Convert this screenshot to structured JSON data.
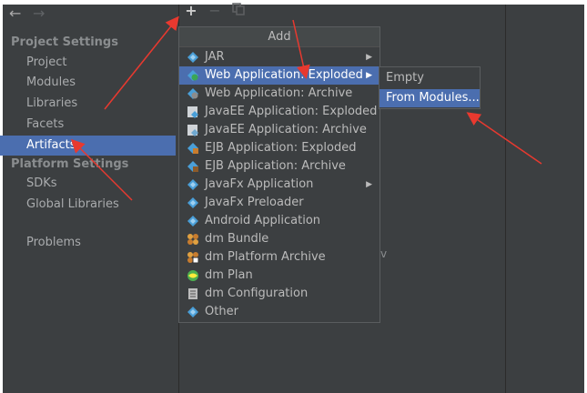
{
  "nav": {
    "back_icon": "arrow-left-icon",
    "forward_icon": "arrow-right-icon"
  },
  "sidebar": {
    "project_settings_title": "Project Settings",
    "project_items": [
      {
        "label": "Project",
        "selected": false
      },
      {
        "label": "Modules",
        "selected": false
      },
      {
        "label": "Libraries",
        "selected": false
      },
      {
        "label": "Facets",
        "selected": false
      },
      {
        "label": "Artifacts",
        "selected": true
      }
    ],
    "platform_settings_title": "Platform Settings",
    "platform_items": [
      {
        "label": "SDKs"
      },
      {
        "label": "Global Libraries"
      }
    ],
    "other_items": [
      {
        "label": "Problems"
      }
    ]
  },
  "toolbar": {
    "add_icon": "plus-icon",
    "remove_icon": "minus-icon",
    "copy_icon": "copy-icon"
  },
  "add_menu": {
    "title": "Add",
    "items": [
      {
        "label": "JAR",
        "icon": "diamond-icon",
        "submenu": true
      },
      {
        "label": "Web Application: Exploded",
        "icon": "web-app-icon",
        "submenu": true,
        "active": true
      },
      {
        "label": "Web Application: Archive",
        "icon": "web-archive-icon"
      },
      {
        "label": "JavaEE Application: Exploded",
        "icon": "javaee-icon"
      },
      {
        "label": "JavaEE Application: Archive",
        "icon": "javaee-archive-icon"
      },
      {
        "label": "EJB Application: Exploded",
        "icon": "ejb-icon"
      },
      {
        "label": "EJB Application: Archive",
        "icon": "ejb-archive-icon"
      },
      {
        "label": "JavaFx Application",
        "icon": "diamond-icon",
        "submenu": true
      },
      {
        "label": "JavaFx Preloader",
        "icon": "diamond-icon"
      },
      {
        "label": "Android Application",
        "icon": "diamond-icon"
      },
      {
        "label": "dm Bundle",
        "icon": "bundle-icon"
      },
      {
        "label": "dm Platform Archive",
        "icon": "platform-archive-icon"
      },
      {
        "label": "dm Plan",
        "icon": "globe-icon"
      },
      {
        "label": "dm Configuration",
        "icon": "config-doc-icon"
      },
      {
        "label": "Other",
        "icon": "diamond-icon"
      }
    ]
  },
  "submenu": {
    "items": [
      {
        "label": "Empty",
        "active": false
      },
      {
        "label": "From Modules...",
        "active": true
      }
    ]
  },
  "stray_char": "v",
  "colors": {
    "background": "#3c3f41",
    "selection": "#4b6eaf",
    "annotation_arrow": "#e8392f"
  }
}
